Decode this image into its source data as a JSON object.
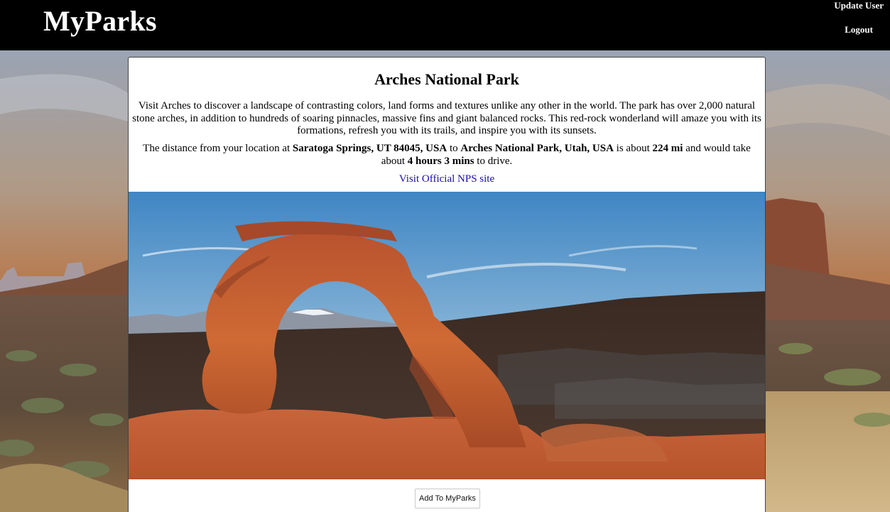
{
  "header": {
    "brand": "MyParks",
    "nav": {
      "update_user": "Update User",
      "logout": "Logout"
    }
  },
  "park": {
    "title": "Arches National Park",
    "description": "Visit Arches to discover a landscape of contrasting colors, land forms and textures unlike any other in the world. The park has over 2,000 natural stone arches, in addition to hundreds of soaring pinnacles, massive fins and giant balanced rocks. This red-rock wonderland will amaze you with its formations, refresh you with its trails, and inspire you with its sunsets.",
    "distance": {
      "prefix": "The distance from your location at ",
      "origin": "Saratoga Springs, UT 84045, USA",
      "to": " to ",
      "destination": "Arches National Park, Utah, USA",
      "is_about": " is about ",
      "miles": "224 mi",
      "would_take": " and would take about ",
      "duration": "4 hours 3 mins",
      "suffix": " to drive."
    },
    "nps_link": "Visit Official NPS site",
    "add_button": "Add To MyParks"
  },
  "colors": {
    "header_bg": "#000000",
    "link": "#1a0dab",
    "rock": "#c4582a"
  }
}
